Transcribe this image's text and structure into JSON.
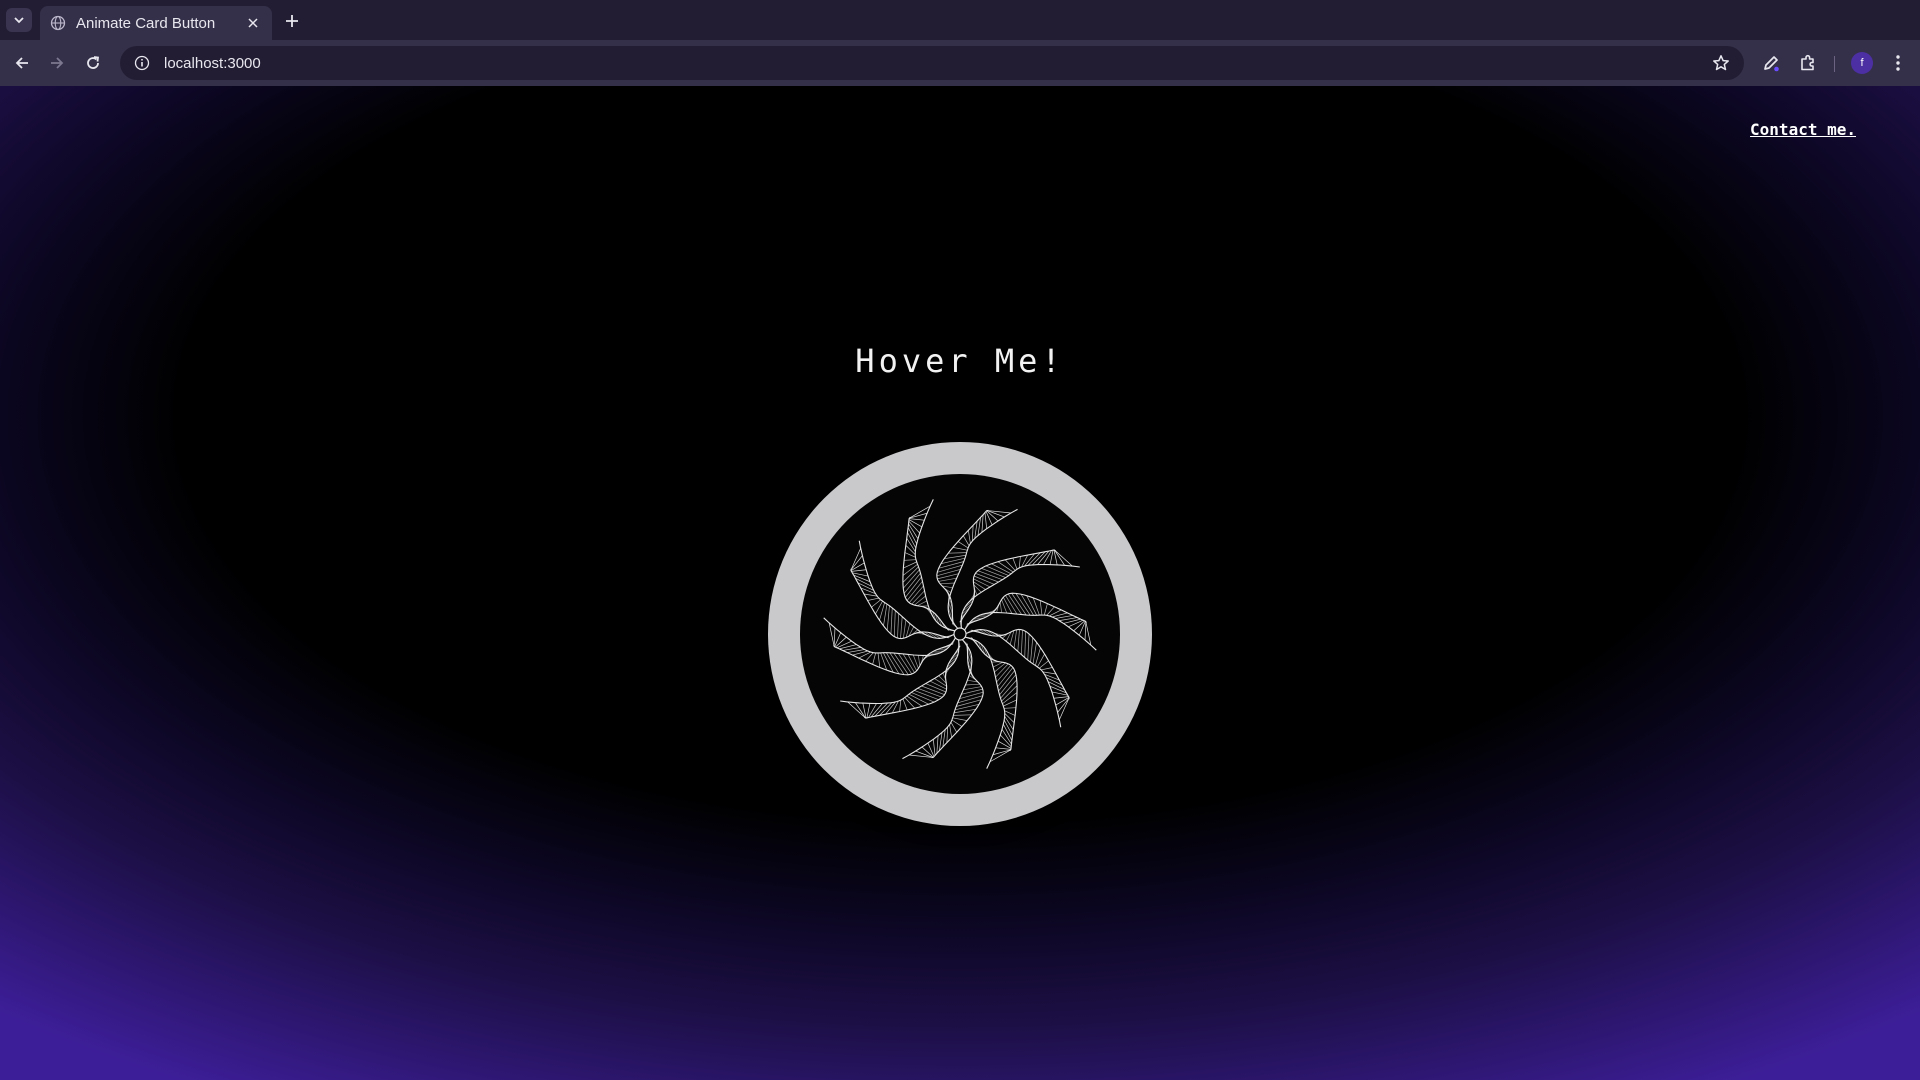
{
  "browser": {
    "tab_title": "Animate Card Button",
    "url": "localhost:3000",
    "profile_initial": "f"
  },
  "icons": {
    "tab_list": "chevron-down-icon",
    "favicon": "globe-icon",
    "tab_close": "close-icon",
    "new_tab": "plus-icon",
    "back": "arrow-left-icon",
    "forward": "arrow-right-icon",
    "reload": "reload-icon",
    "site_info": "info-icon",
    "bookmark": "star-icon",
    "edit": "pen-icon",
    "extensions": "puzzle-icon",
    "menu": "kebab-icon"
  },
  "page": {
    "contact_link": "Contact me.",
    "title": "Hover Me!"
  },
  "colors": {
    "background_bottom": "#3d1e99",
    "card_ring": "#c9c9cc",
    "card_center": "#050505",
    "pattern_stroke": "#e6e6e6"
  }
}
